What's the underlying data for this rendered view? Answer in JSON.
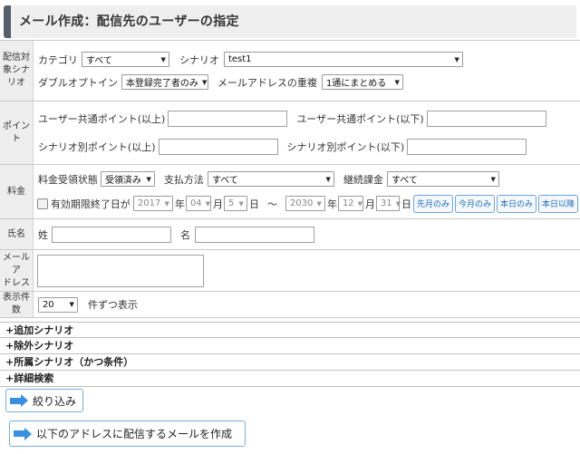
{
  "page": {
    "title": "メール作成：配信先のユーザーの指定"
  },
  "scenario": {
    "label": "配信対象シナリオ",
    "category_label": "カテゴリ",
    "category_value": "すべて",
    "scenario_label": "シナリオ",
    "scenario_value": "test1",
    "double_optin_label": "ダブルオプトイン",
    "double_optin_value": "本登録完了者のみ",
    "duplicate_label": "メールアドレスの重複",
    "duplicate_value": "1通にまとめる"
  },
  "points": {
    "label": "ポイント",
    "common_min_label": "ユーザー共通ポイント(以上)",
    "common_max_label": "ユーザー共通ポイント(以下)",
    "scenario_min_label": "シナリオ別ポイント(以上)",
    "scenario_max_label": "シナリオ別ポイント(以下)"
  },
  "fee": {
    "label": "料金",
    "status_label": "料金受領状態",
    "status_value": "受領済み",
    "payment_label": "支払方法",
    "payment_value": "すべて",
    "recurring_label": "継続課金",
    "recurring_value": "すべて",
    "expiry_label": "有効期限終了日が",
    "from_year": "2017",
    "year_unit": "年",
    "from_month": "04",
    "month_unit": "月",
    "from_day": "5",
    "day_unit": "日",
    "range_sep": "〜",
    "to_year": "2030",
    "to_month": "12",
    "to_day": "31",
    "btn_last_month": "先月のみ",
    "btn_this_month": "今月のみ",
    "btn_today": "本日のみ",
    "btn_after_today": "本日以降"
  },
  "name": {
    "label": "氏名",
    "last_label": "姓",
    "first_label": "名"
  },
  "email": {
    "label_line1": "メールア",
    "label_line2": "ドレス"
  },
  "display": {
    "label": "表示件数",
    "value": "20",
    "suffix": "件ずつ表示"
  },
  "sections": {
    "additional": "+追加シナリオ",
    "excluded": "+除外シナリオ",
    "belonging": "+所属シナリオ（かつ条件）",
    "detail": "+詳細検索"
  },
  "actions": {
    "filter": "絞り込み",
    "create_mail": "以下のアドレスに配信するメールを作成"
  },
  "colors": {
    "accent": "#3b8fe0",
    "title_bar_edge": "#555f6b",
    "button_border": "#7cabd8"
  }
}
